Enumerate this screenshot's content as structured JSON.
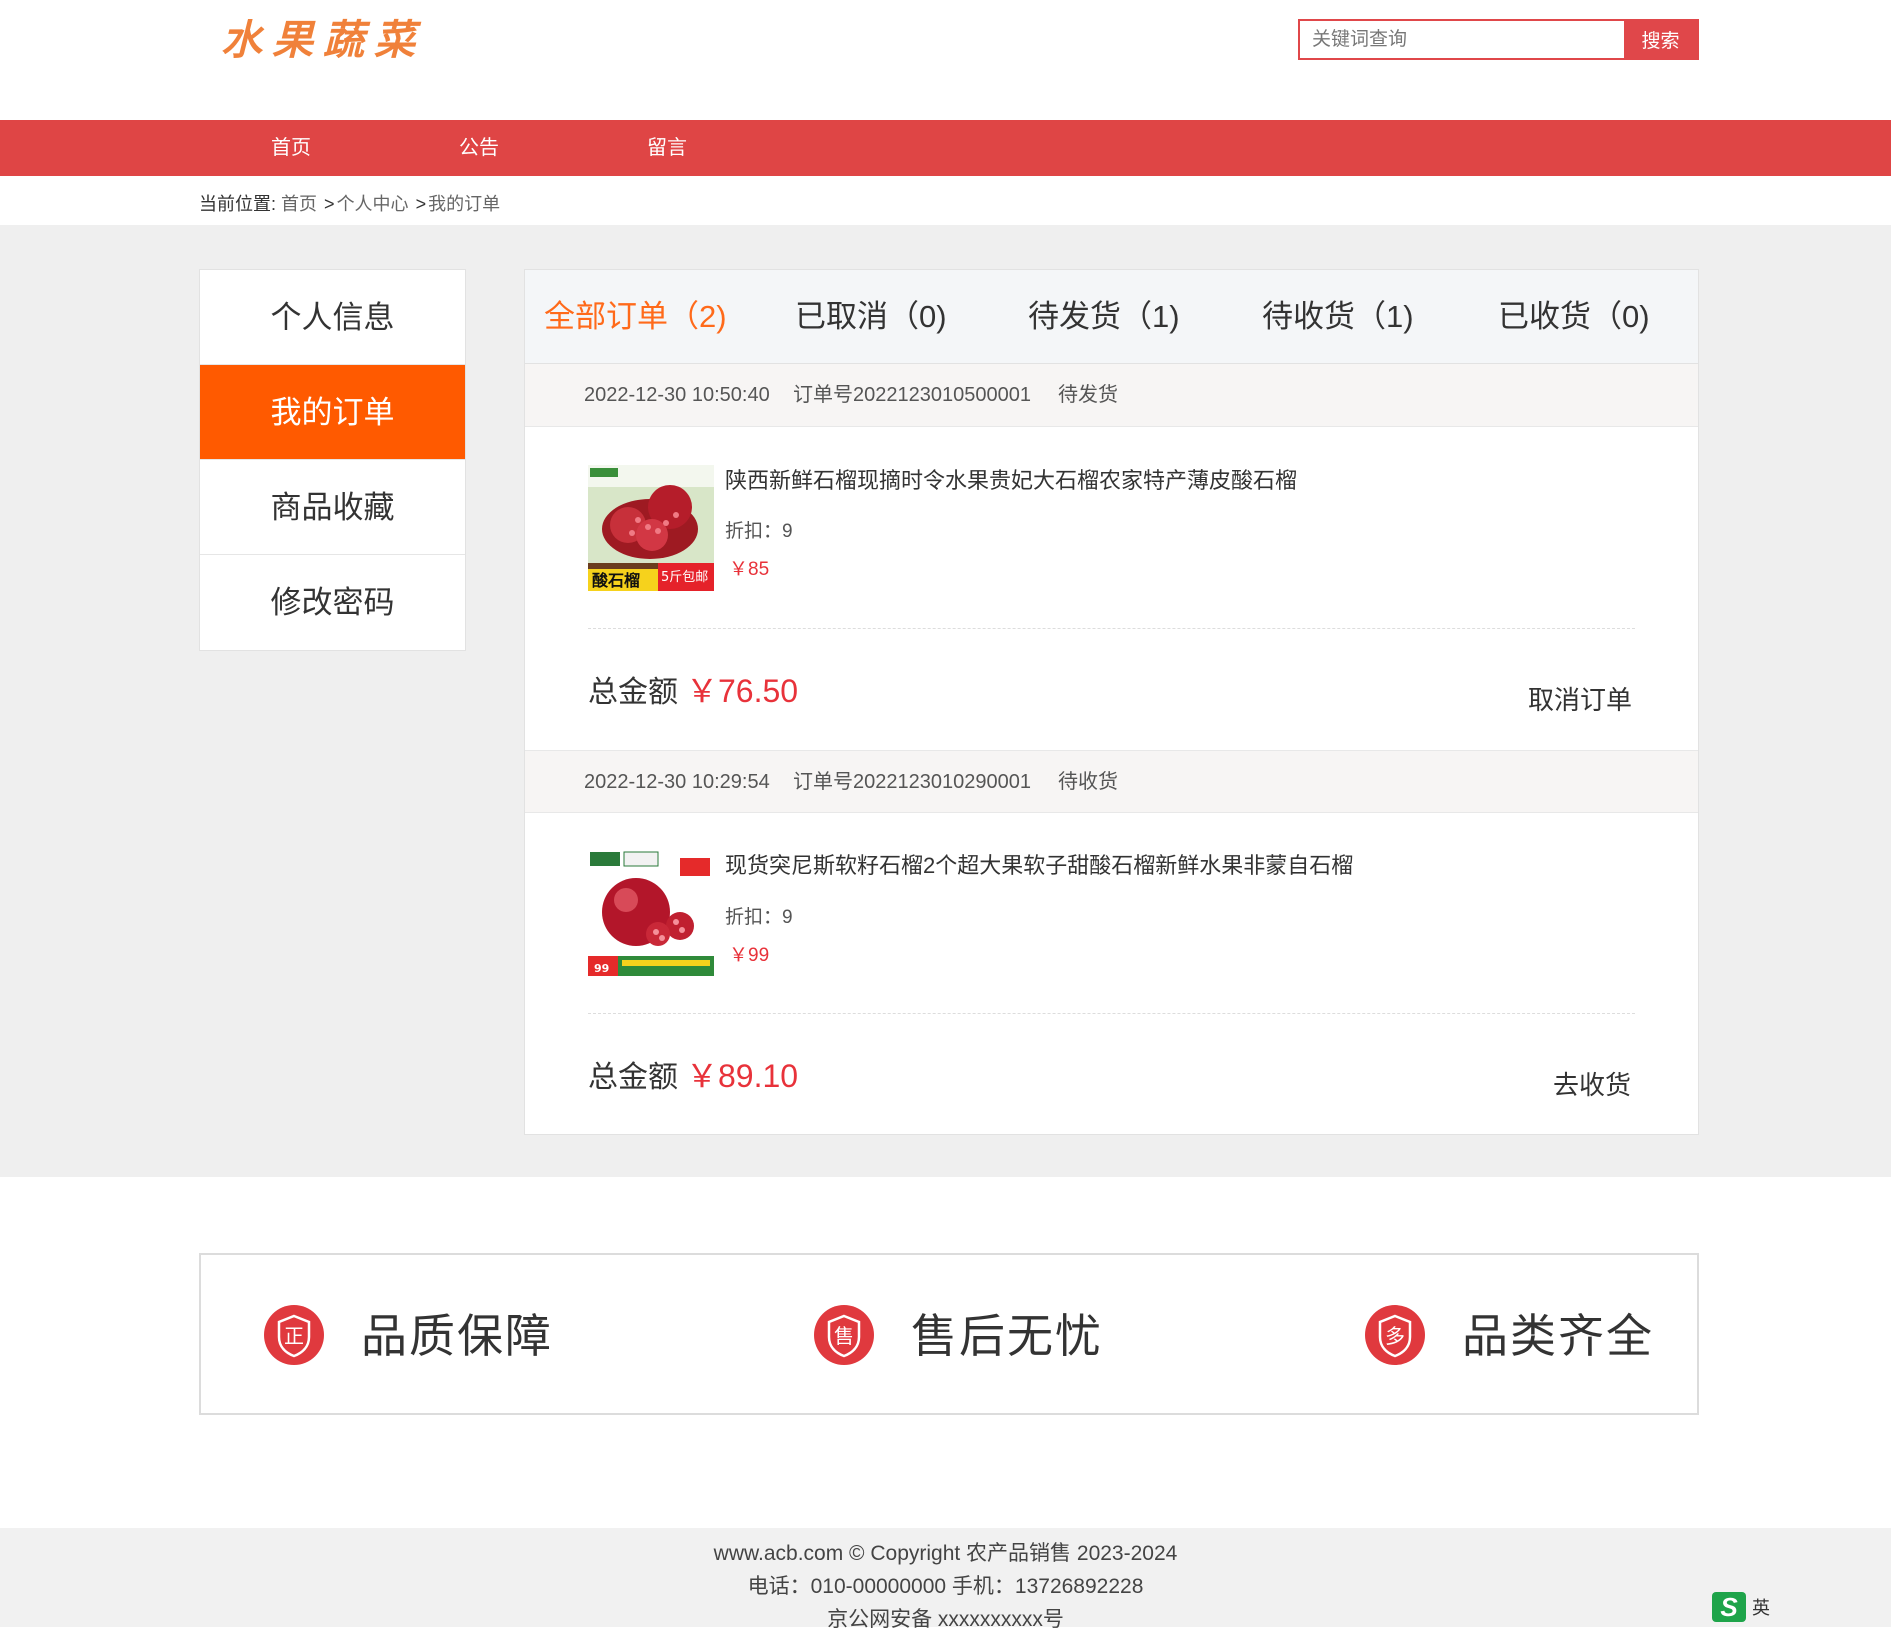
{
  "header": {
    "logo_text": "水果蔬菜",
    "search_placeholder": "关键词查询",
    "search_button": "搜索"
  },
  "nav": {
    "items": [
      "首页",
      "公告",
      "留言"
    ]
  },
  "breadcrumb": {
    "label": "当前位置:",
    "items": [
      "首页",
      "个人中心",
      "我的订单"
    ],
    "separator": ">"
  },
  "sidebar": {
    "items": [
      "个人信息",
      "我的订单",
      "商品收藏",
      "修改密码"
    ],
    "active": "我的订单"
  },
  "tabs": [
    "全部订单（2)",
    "已取消（0)",
    "待发货（1)",
    "待收货（1)",
    "已收货（0)"
  ],
  "orders": [
    {
      "time": "2022-12-30 10:50:40",
      "order_no": "订单号2022123010500001",
      "status": "待发货",
      "product": {
        "name": "陕西新鲜石榴现摘时令水果贵妃大石榴农家特产薄皮酸石榴",
        "discount": "折扣：9",
        "price": "￥85",
        "image_labels": [
          "酸石榴",
          "5斤包邮"
        ]
      },
      "total_label": "总金额",
      "total": "￥76.50",
      "action": "取消订单"
    },
    {
      "time": "2022-12-30 10:29:54",
      "order_no": "订单号2022123010290001",
      "status": "待收货",
      "product": {
        "name": "现货突尼斯软籽石榴2个超大果软子甜酸石榴新鲜水果非蒙自石榴",
        "discount": "折扣：9",
        "price": "￥99",
        "image_labels": [
          "99"
        ]
      },
      "total_label": "总金额",
      "total": "￥89.10",
      "action": "去收货"
    }
  ],
  "features": [
    {
      "icon": "quality-shield-icon",
      "glyph": "正",
      "text": "品质保障"
    },
    {
      "icon": "after-sales-shield-icon",
      "glyph": "售",
      "text": "售后无忧"
    },
    {
      "icon": "variety-shield-icon",
      "glyph": "多",
      "text": "品类齐全"
    }
  ],
  "footer": {
    "line1": "www.acb.com © Copyright 农产品销售 2023-2024",
    "line2": "电话：010-00000000 手机：13726892228",
    "line3": "京公网安备 xxxxxxxxxx号"
  },
  "tray": {
    "ime": "英"
  },
  "colors": {
    "nav_red": "#df4545",
    "active_orange": "#ff5a00",
    "tab_active": "#ff6a1a",
    "price_red": "#e8323a",
    "logo_orange": "#f0813a"
  }
}
